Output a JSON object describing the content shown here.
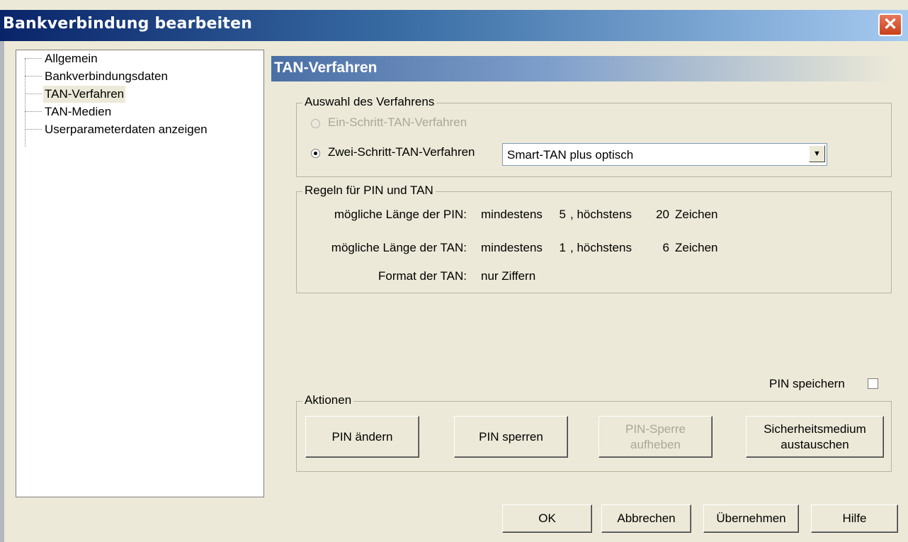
{
  "window": {
    "title": "Bankverbindung bearbeiten",
    "close_glyph": "✕"
  },
  "tree": {
    "items": [
      {
        "label": "Allgemein"
      },
      {
        "label": "Bankverbindungsdaten"
      },
      {
        "label": "TAN-Verfahren",
        "selected": true
      },
      {
        "label": "TAN-Medien"
      },
      {
        "label": "Userparameterdaten anzeigen"
      }
    ]
  },
  "panel": {
    "title": "TAN-Verfahren",
    "auswahl": {
      "legend": "Auswahl des Verfahrens",
      "option1": {
        "label": "Ein-Schritt-TAN-Verfahren",
        "enabled": false,
        "checked": false
      },
      "option2": {
        "label": "Zwei-Schritt-TAN-Verfahren",
        "enabled": true,
        "checked": true
      },
      "dropdown_value": "Smart-TAN plus optisch",
      "dropdown_arrow": "▼"
    },
    "regeln": {
      "legend": "Regeln für PIN und TAN",
      "pin_label": "mögliche Länge der PIN:",
      "pin_min_label": "mindestens",
      "pin_min": "5",
      "pin_sep": ", höchstens",
      "pin_max": "20",
      "pin_unit": "Zeichen",
      "tan_label": "mögliche Länge der TAN:",
      "tan_min_label": "mindestens",
      "tan_min": "1",
      "tan_sep": ", höchstens",
      "tan_max": "6",
      "tan_unit": "Zeichen",
      "format_label": "Format der TAN:",
      "format_value": "nur Ziffern"
    },
    "pin_speichern": {
      "label": "PIN speichern",
      "checked": false
    },
    "aktionen": {
      "legend": "Aktionen",
      "pin_aendern": "PIN ändern",
      "pin_sperren": "PIN sperren",
      "pin_sperre_aufheben_1": "PIN-Sperre",
      "pin_sperre_aufheben_2": "aufheben",
      "sicherheitsmedium_1": "Sicherheitsmedium",
      "sicherheitsmedium_2": "austauschen"
    }
  },
  "footer": {
    "ok": "OK",
    "abbrechen": "Abbrechen",
    "uebernehmen": "Übernehmen",
    "hilfe": "Hilfe"
  }
}
